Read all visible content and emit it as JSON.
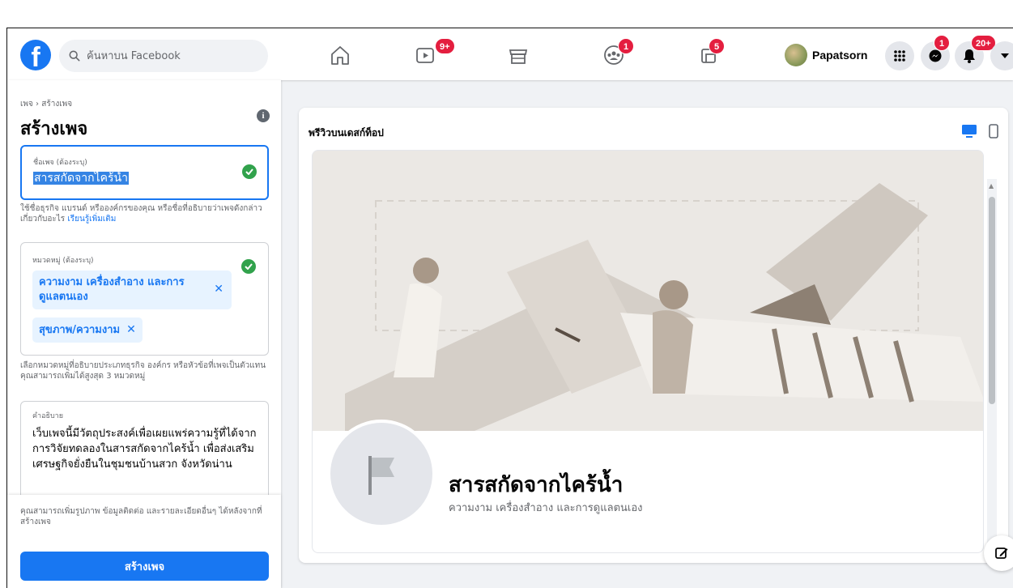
{
  "topbar": {
    "logo": "f",
    "search_placeholder": "ค้นหาบน Facebook",
    "nav_icons": [
      "home-icon",
      "watch-icon",
      "marketplace-icon",
      "groups-icon",
      "gaming-icon"
    ],
    "watch_badge": "9+",
    "groups_badge": "1",
    "gaming_badge": "5",
    "profile_name": "Papatsorn",
    "messenger_badge": "1",
    "notifications_badge": "20+"
  },
  "sidebar": {
    "breadcrumb": "เพจ › สร้างเพจ",
    "title": "สร้างเพจ",
    "name_field": {
      "label": "ชื่อเพจ (ต้องระบุ)",
      "value": "สารสกัดจากไคร้น้ำ",
      "help_text": "ใช้ชื่อธุรกิจ แบรนด์ หรือองค์กรของคุณ หรือชื่อที่อธิบายว่าเพจดังกล่าวเกี่ยวกับอะไร",
      "learn_more": "เรียนรู้เพิ่มเติม"
    },
    "category_field": {
      "label": "หมวดหมู่ (ต้องระบุ)",
      "chips": [
        "ความงาม เครื่องสำอาง และการดูแลตนเอง",
        "สุขภาพ/ความงาม"
      ],
      "help_text": "เลือกหมวดหมู่ที่อธิบายประเภทธุรกิจ องค์กร หรือหัวข้อที่เพจเป็นตัวแทน คุณสามารถเพิ่มได้สูงสุด 3 หมวดหมู่"
    },
    "description_field": {
      "label": "คำอธิบาย",
      "value": "เว็บเพจนี้มีวัตถุประสงค์เพื่อเผยแพร่ความรู้ที่ได้จากการวิจัยทดลองในสารสกัดจากไคร้น้ำ เพื่อส่งเสริมเศรษฐกิจยั่งยืนในชุมชนบ้านสวก จังหวัดน่าน"
    },
    "bottom_note": "คุณสามารถเพิ่มรูปภาพ ข้อมูลติดต่อ และรายละเอียดอื่นๆ ได้หลังจากที่สร้างเพจ",
    "create_button": "สร้างเพจ"
  },
  "preview": {
    "title": "พรีวิวบนเดสก์ท็อป",
    "page_name": "สารสกัดจากไคร้น้ำ",
    "page_category": "ความงาม เครื่องสำอาง และการดูแลตนเอง"
  },
  "colors": {
    "accent": "#1877f2",
    "badge": "#e41e3f",
    "success": "#31a24c"
  }
}
